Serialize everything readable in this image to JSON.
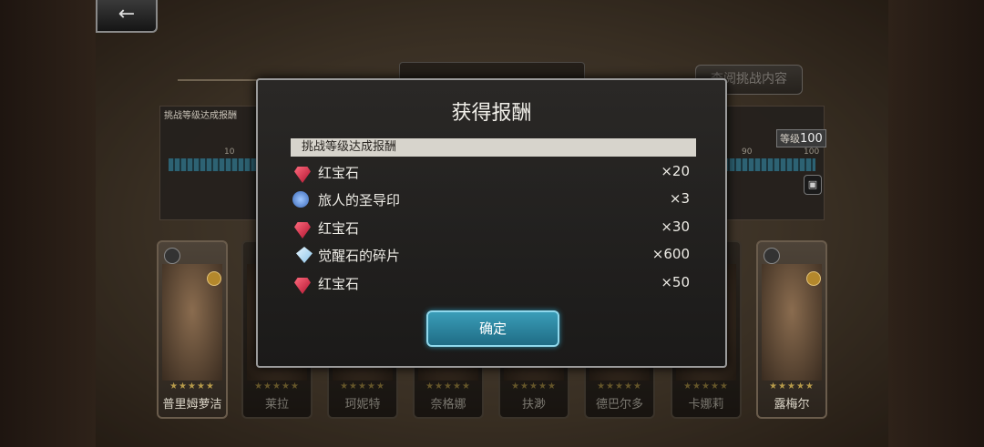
{
  "topbar": {
    "back_icon": "arrow-left-icon",
    "back_label": "←",
    "review_label": "查阅挑战内容"
  },
  "progress": {
    "section_label": "挑战等级达成报酬",
    "level_prefix": "等级",
    "level_value": "100",
    "ticks": [
      "10",
      "90",
      "100"
    ]
  },
  "modal": {
    "title": "获得报酬",
    "section": "挑战等级达成报酬",
    "rewards": [
      {
        "icon": "ruby-icon",
        "name": "红宝石",
        "qty": "×20"
      },
      {
        "icon": "traveler-seal-icon",
        "name": "旅人的圣导印",
        "qty": "×3"
      },
      {
        "icon": "ruby-icon",
        "name": "红宝石",
        "qty": "×30"
      },
      {
        "icon": "awakening-shard-icon",
        "name": "觉醒石的碎片",
        "qty": "×600"
      },
      {
        "icon": "ruby-icon",
        "name": "红宝石",
        "qty": "×50"
      }
    ],
    "confirm": "确定"
  },
  "cards": [
    {
      "name": "普里姆萝洁"
    },
    {
      "name": "莱拉"
    },
    {
      "name": "珂妮特"
    },
    {
      "name": "奈格娜"
    },
    {
      "name": "扶渺"
    },
    {
      "name": "德巴尔多"
    },
    {
      "name": "卡娜莉"
    },
    {
      "name": "露梅尔"
    }
  ]
}
